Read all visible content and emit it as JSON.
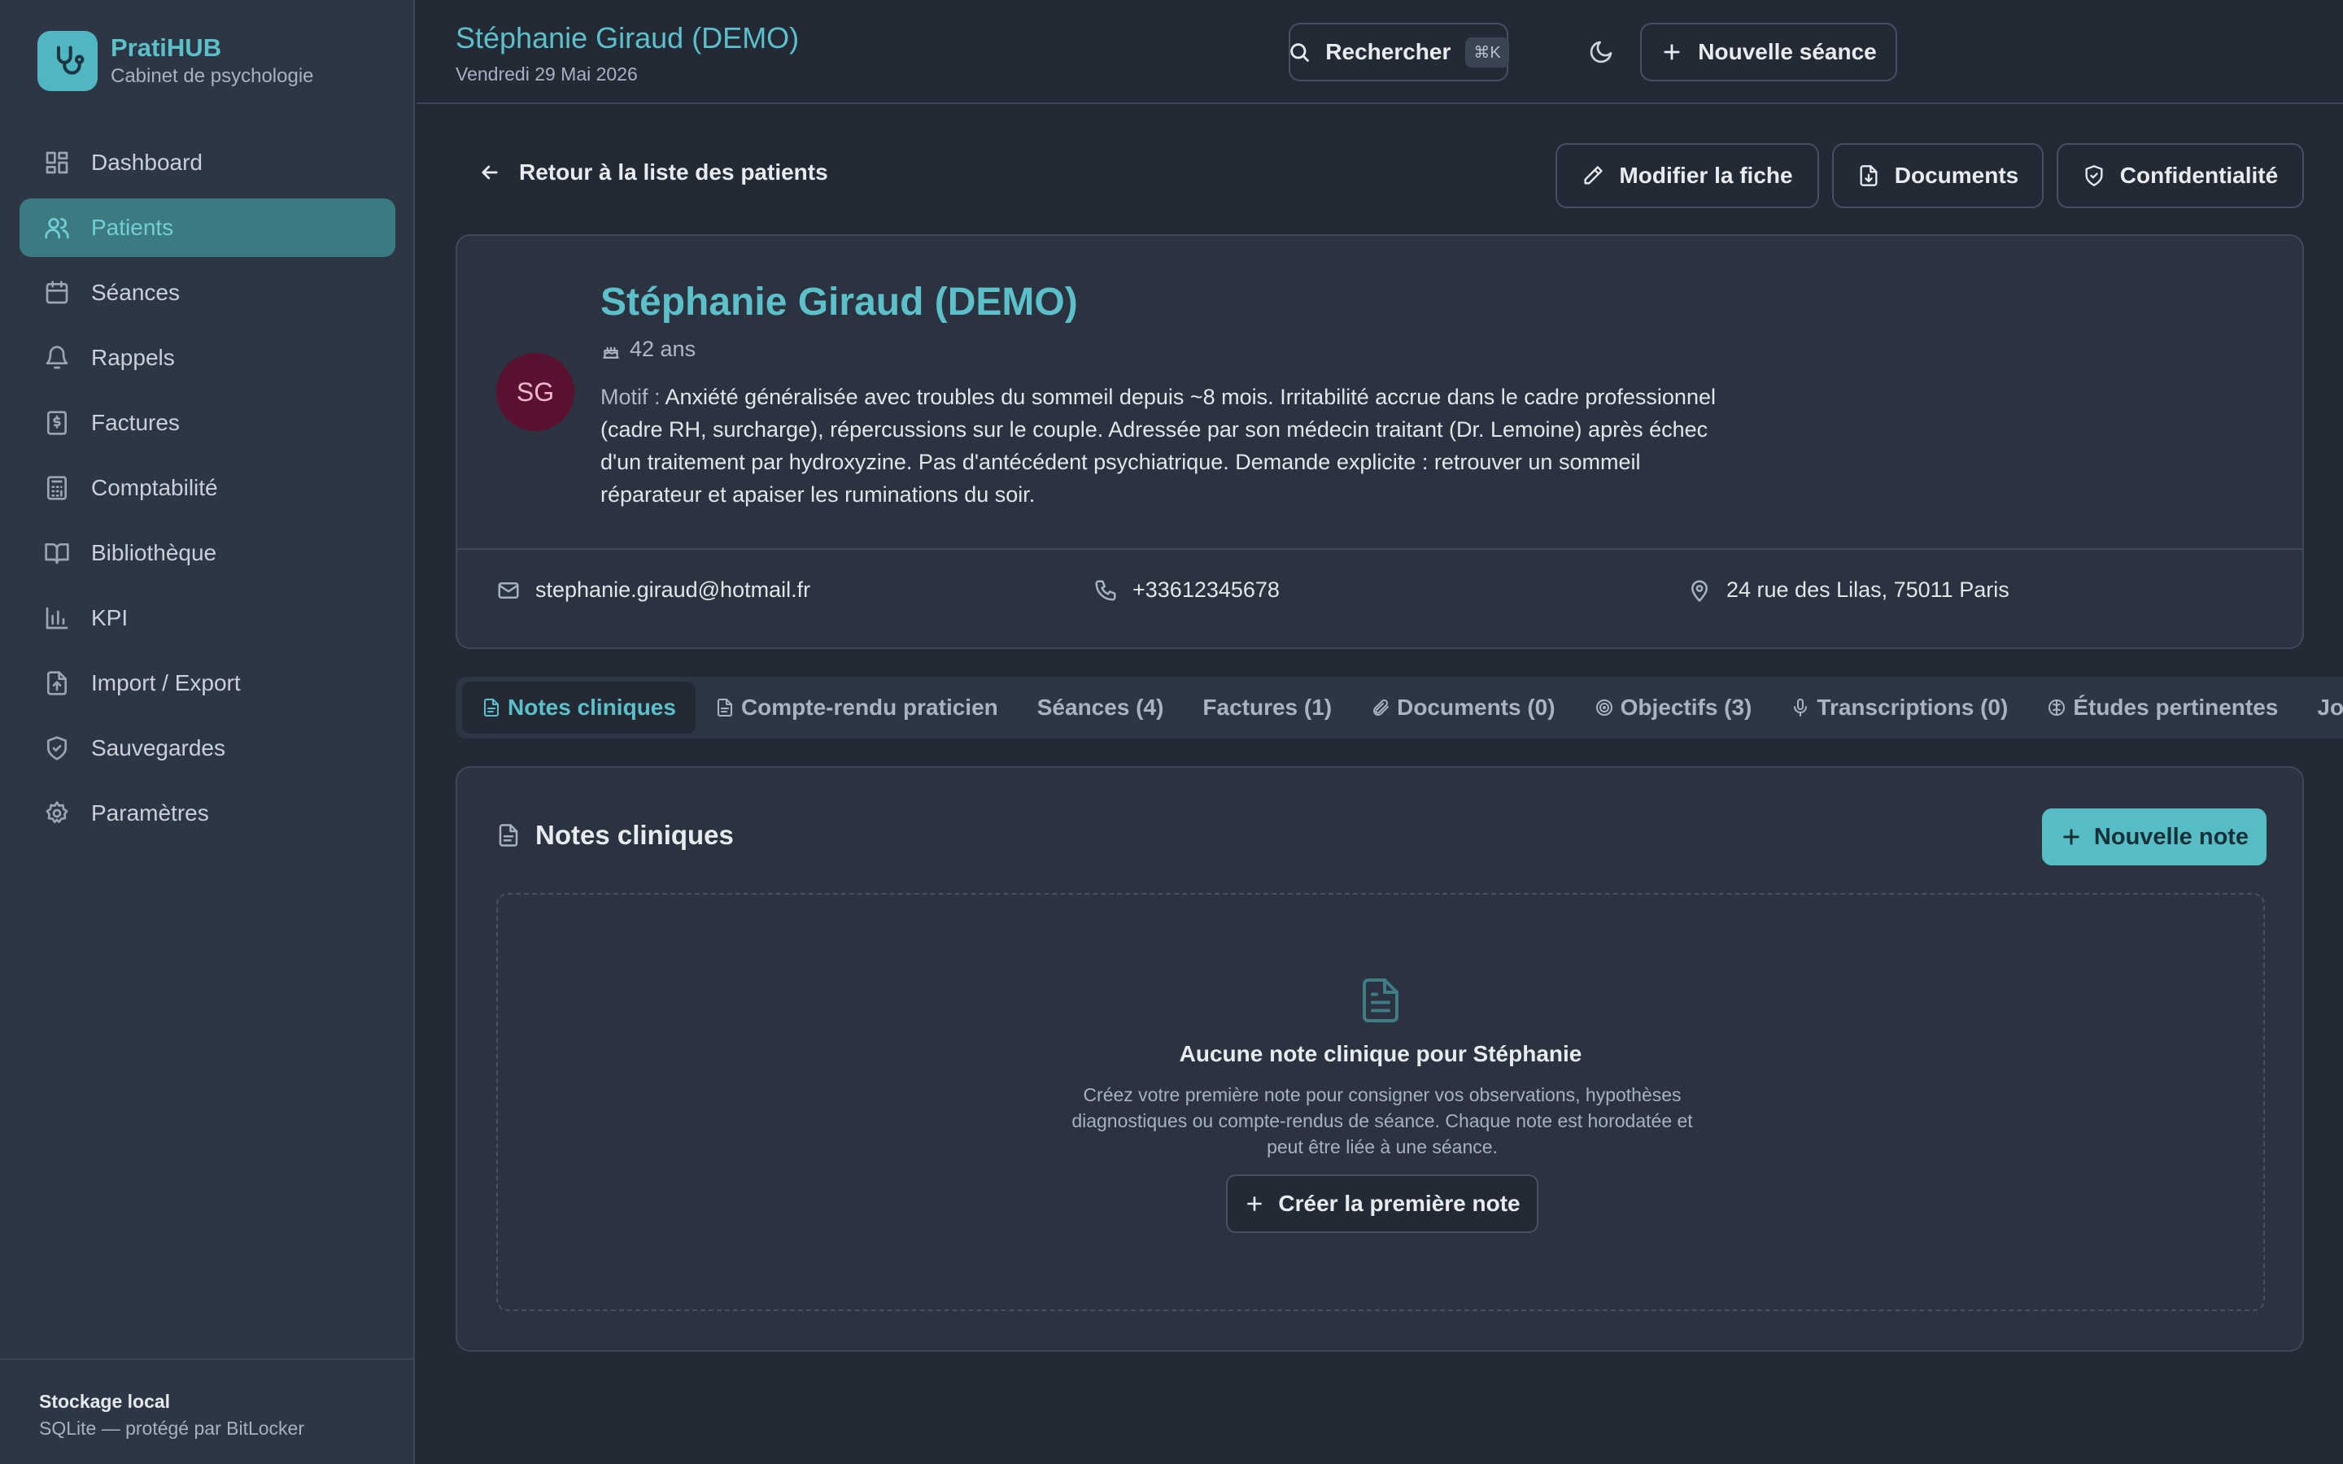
{
  "brand": {
    "name": "PratiHUB",
    "subtitle": "Cabinet de psychologie"
  },
  "nav": {
    "items": [
      {
        "label": "Dashboard",
        "icon": "dashboard-icon",
        "active": false
      },
      {
        "label": "Patients",
        "icon": "users-icon",
        "active": true
      },
      {
        "label": "Séances",
        "icon": "calendar-icon",
        "active": false
      },
      {
        "label": "Rappels",
        "icon": "bell-icon",
        "active": false
      },
      {
        "label": "Factures",
        "icon": "receipt-icon",
        "active": false
      },
      {
        "label": "Comptabilité",
        "icon": "calculator-icon",
        "active": false
      },
      {
        "label": "Bibliothèque",
        "icon": "book-icon",
        "active": false
      },
      {
        "label": "KPI",
        "icon": "bar-chart-icon",
        "active": false
      },
      {
        "label": "Import / Export",
        "icon": "file-import-icon",
        "active": false
      },
      {
        "label": "Sauvegardes",
        "icon": "shield-icon",
        "active": false
      },
      {
        "label": "Paramètres",
        "icon": "gear-icon",
        "active": false
      }
    ]
  },
  "storage": {
    "title": "Stockage local",
    "subtitle": "SQLite — protégé par BitLocker"
  },
  "topbar": {
    "title": "Stéphanie Giraud (DEMO)",
    "date": "Vendredi 29 Mai 2026",
    "search_label": "Rechercher",
    "search_shortcut": "⌘K",
    "new_session_label": "Nouvelle séance"
  },
  "actions": {
    "back_label": "Retour à la liste des patients",
    "edit_label": "Modifier la fiche",
    "documents_label": "Documents",
    "privacy_label": "Confidentialité"
  },
  "patient": {
    "initials": "SG",
    "name": "Stéphanie Giraud (DEMO)",
    "age": "42 ans",
    "motif_label": "Motif :",
    "motif": "Anxiété généralisée avec troubles du sommeil depuis ~8 mois. Irritabilité accrue dans le cadre professionnel (cadre RH, surcharge), répercussions sur le couple. Adressée par son médecin traitant (Dr. Lemoine) après échec d'un traitement par hydroxyzine. Pas d'antécédent psychiatrique. Demande explicite : retrouver un sommeil réparateur et apaiser les ruminations du soir.",
    "email": "stephanie.giraud@hotmail.fr",
    "phone": "+33612345678",
    "address": "24 rue des Lilas, 75011 Paris"
  },
  "tabs": [
    {
      "label": "Notes cliniques",
      "icon": "file-text-icon",
      "active": true
    },
    {
      "label": "Compte-rendu praticien",
      "icon": "file-text-icon",
      "active": false
    },
    {
      "label": "Séances (4)",
      "icon": "",
      "active": false
    },
    {
      "label": "Factures (1)",
      "icon": "",
      "active": false
    },
    {
      "label": "Documents (0)",
      "icon": "paperclip-icon",
      "active": false
    },
    {
      "label": "Objectifs (3)",
      "icon": "target-icon",
      "active": false
    },
    {
      "label": "Transcriptions (0)",
      "icon": "mic-icon",
      "active": false
    },
    {
      "label": "Études pertinentes",
      "icon": "brain-icon",
      "active": false
    },
    {
      "label": "Journal d",
      "icon": "",
      "active": false
    }
  ],
  "notes": {
    "title": "Notes cliniques",
    "new_note_label": "Nouvelle note",
    "empty_title": "Aucune note clinique pour Stéphanie",
    "empty_description": "Créez votre première note pour consigner vos observations, hypothèses diagnostiques ou compte-rendus de séance. Chaque note est horodatée et peut être liée à une séance.",
    "create_first_label": "Créer la première note"
  },
  "colors": {
    "accent": "#5bc0c9",
    "background": "#232a36",
    "sidebar": "#2d3644",
    "active_nav": "#3a7a80",
    "avatar": "#5a1030"
  }
}
